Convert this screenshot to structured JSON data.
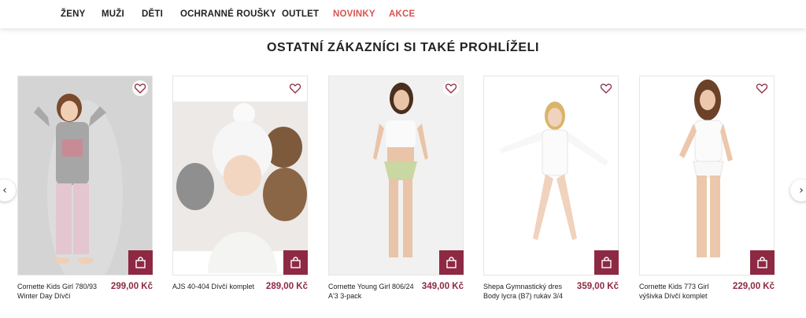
{
  "nav": {
    "items": [
      {
        "label": "ŽENY"
      },
      {
        "label": "MUŽI"
      },
      {
        "label": "DĚTI"
      },
      {
        "label": "OCHRANNÉ ROUŠKY"
      },
      {
        "label": "OUTLET"
      },
      {
        "label": "NOVINKY",
        "highlight": "#d9534f"
      },
      {
        "label": "AKCE",
        "highlight": "#d9534f"
      }
    ]
  },
  "section": {
    "title": "OSTATNÍ ZÁKAZNÍCI SI TAKÉ PROHLÍŽELI"
  },
  "carousel": {
    "prev_icon": "chevron-left-icon",
    "next_icon": "chevron-right-icon",
    "prev_glyph": "‹",
    "next_glyph": "›"
  },
  "products": [
    {
      "name": "Cornette Kids Girl 780/93 Winter Day Dívčí",
      "price": "299,00 Kč"
    },
    {
      "name": "AJS 40-404 Dívčí komplet",
      "price": "289,00 Kč"
    },
    {
      "name": "Cornette Young Girl 806/24 A'3 3-pack",
      "price": "349,00 Kč"
    },
    {
      "name": "Shepa Gymnastický dres Body lycra (B7) rukáv 3/4",
      "price": "359,00 Kč"
    },
    {
      "name": "Cornette Kids 773 Girl výšivka Dívčí komplet",
      "price": "229,00 Kč"
    }
  ],
  "colors": {
    "accent": "#8e2943",
    "nav_highlight": "#d9534f"
  }
}
